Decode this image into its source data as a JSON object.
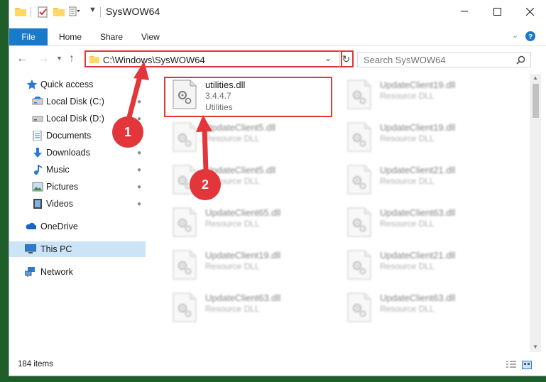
{
  "window": {
    "title": "SysWOW64",
    "minimize_icon": "minimize-icon",
    "maximize_icon": "maximize-icon",
    "close_icon": "close-icon"
  },
  "ribbon": {
    "tabs": [
      "File",
      "Home",
      "Share",
      "View"
    ]
  },
  "address": {
    "path": "C:\\Windows\\SysWOW64",
    "search_placeholder": "Search SysWOW64"
  },
  "sidebar": {
    "items": [
      {
        "label": "Quick access",
        "icon": "star-icon"
      },
      {
        "label": "Local Disk (C:)",
        "icon": "drive-icon"
      },
      {
        "label": "Local Disk (D:)",
        "icon": "drive-icon"
      },
      {
        "label": "Documents",
        "icon": "documents-icon"
      },
      {
        "label": "Downloads",
        "icon": "download-icon"
      },
      {
        "label": "Music",
        "icon": "music-icon"
      },
      {
        "label": "Pictures",
        "icon": "pictures-icon"
      },
      {
        "label": "Videos",
        "icon": "videos-icon"
      },
      {
        "label": "OneDrive",
        "icon": "cloud-icon"
      },
      {
        "label": "This PC",
        "icon": "computer-icon"
      },
      {
        "label": "Network",
        "icon": "network-icon"
      }
    ]
  },
  "files": [
    {
      "name": "utilities.dll",
      "version": "3.4.4.7",
      "description": "Utilities"
    },
    {
      "name": "UpdateClient19.dll",
      "description": "Resource DLL"
    },
    {
      "name": "UpdateClient5.dll",
      "description": "Resource DLL"
    },
    {
      "name": "UpdateClient19.dll",
      "description": "Resource DLL"
    },
    {
      "name": "UpdateClient5.dll",
      "description": "Resource DLL"
    },
    {
      "name": "UpdateClient21.dll",
      "description": "Resource DLL"
    },
    {
      "name": "UpdateClient65.dll",
      "description": "Resource DLL"
    },
    {
      "name": "UpdateClient63.dll",
      "description": "Resource DLL"
    },
    {
      "name": "UpdateClient19.dll",
      "description": "Resource DLL"
    },
    {
      "name": "UpdateClient21.dll",
      "description": "Resource DLL"
    },
    {
      "name": "UpdateClient63.dll",
      "description": "Resource DLL"
    },
    {
      "name": "UpdateClient63.dll",
      "description": "Resource DLL"
    }
  ],
  "annotations": {
    "step1": "1",
    "step2": "2",
    "color": "#e2363b"
  },
  "status": {
    "item_count": "184 items"
  },
  "colors": {
    "accent": "#1979ca",
    "selection": "#cce4f7",
    "highlight": "#e2363b"
  }
}
